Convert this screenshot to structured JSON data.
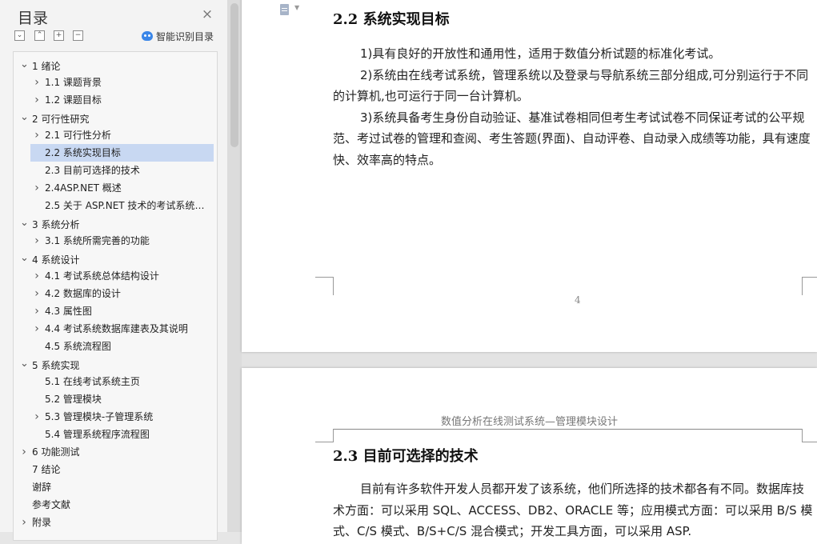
{
  "toc": {
    "title": "目录",
    "close_icon": "×",
    "tools": [
      {
        "name": "collapse-all-button",
        "glyph": "⌄"
      },
      {
        "name": "expand-up-button",
        "glyph": "⌃"
      },
      {
        "name": "add-heading-button",
        "glyph": "+"
      },
      {
        "name": "remove-heading-button",
        "glyph": "−"
      }
    ],
    "smart_label": "智能识别目录",
    "items": [
      {
        "label": "1 绪论",
        "level": 1,
        "chevron": "open"
      },
      {
        "label": "1.1 课题背景",
        "level": 2,
        "chevron": "closed"
      },
      {
        "label": "1.2 课题目标",
        "level": 2,
        "chevron": "closed"
      },
      {
        "label": "2 可行性研究",
        "level": 1,
        "chevron": "open"
      },
      {
        "label": "2.1 可行性分析",
        "level": 2,
        "chevron": "closed"
      },
      {
        "label": "2.2 系统实现目标",
        "level": 2,
        "chevron": "none",
        "selected": true
      },
      {
        "label": "2.3 目前可选择的技术",
        "level": 2,
        "chevron": "none"
      },
      {
        "label": "2.4ASP.NET 概述",
        "level": 2,
        "chevron": "closed"
      },
      {
        "label": "2.5 关于 ASP.NET 技术的考试系统 ...",
        "level": 2,
        "chevron": "none"
      },
      {
        "label": "3 系统分析",
        "level": 1,
        "chevron": "open"
      },
      {
        "label": "3.1 系统所需完善的功能",
        "level": 2,
        "chevron": "closed"
      },
      {
        "label": "4 系统设计",
        "level": 1,
        "chevron": "open"
      },
      {
        "label": "4.1 考试系统总体结构设计",
        "level": 2,
        "chevron": "closed"
      },
      {
        "label": "4.2 数据库的设计",
        "level": 2,
        "chevron": "closed"
      },
      {
        "label": "4.3 属性图",
        "level": 2,
        "chevron": "closed"
      },
      {
        "label": "4.4 考试系统数据库建表及其说明",
        "level": 2,
        "chevron": "closed"
      },
      {
        "label": "4.5 系统流程图",
        "level": 2,
        "chevron": "none"
      },
      {
        "label": "5 系统实现",
        "level": 1,
        "chevron": "open"
      },
      {
        "label": "5.1 在线考试系统主页",
        "level": 2,
        "chevron": "none"
      },
      {
        "label": "5.2 管理模块",
        "level": 2,
        "chevron": "none"
      },
      {
        "label": "5.3 管理模块-子管理系统",
        "level": 2,
        "chevron": "closed"
      },
      {
        "label": "5.4 管理系统程序流程图",
        "level": 2,
        "chevron": "none"
      },
      {
        "label": "6 功能测试",
        "level": 1,
        "chevron": "closed"
      },
      {
        "label": "7 结论",
        "level": 1,
        "chevron": "none"
      },
      {
        "label": "谢辞",
        "level": 1,
        "chevron": "none"
      },
      {
        "label": "参考文献",
        "level": 1,
        "chevron": "none"
      },
      {
        "label": "附录",
        "level": 1,
        "chevron": "closed"
      }
    ]
  },
  "page1": {
    "heading": "2.2  系统实现目标",
    "paragraphs": [
      "1)具有良好的开放性和通用性，适用于数值分析试题的标准化考试。",
      "2)系统由在线考试系统，管理系统以及登录与导航系统三部分组成,可分别运行于不同的计算机,也可运行于同一台计算机。",
      "3)系统具备考生身份自动验证、基准试卷相同但考生考试试卷不同保证考试的公平规范、考过试卷的管理和查阅、考生答题(界面)、自动评卷、自动录入成绩等功能，具有速度快、效率高的特点。"
    ],
    "page_number": "4"
  },
  "page2": {
    "header": "数值分析在线测试系统—管理模块设计",
    "heading": "2.3  目前可选择的技术",
    "paragraphs": [
      "目前有许多软件开发人员都开发了该系统，他们所选择的技术都各有不同。数据库技术方面：可以采用 SQL、ACCESS、DB2、ORACLE 等；应用模式方面：可以采用 B/S 模式、C/S 模式、B/S+C/S 混合模式；开发工具方面，可以采用 ASP."
    ]
  }
}
